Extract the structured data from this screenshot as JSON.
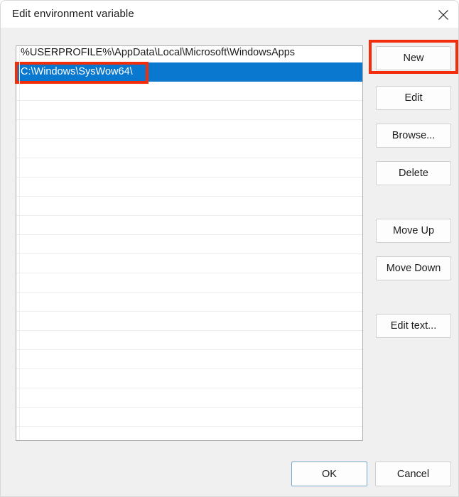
{
  "window": {
    "title": "Edit environment variable",
    "close_icon": "close-icon"
  },
  "list": {
    "rows": [
      {
        "text": "%USERPROFILE%\\AppData\\Local\\Microsoft\\WindowsApps",
        "selected": false
      },
      {
        "text": "C:\\Windows\\SysWow64\\",
        "selected": true
      },
      {
        "text": "",
        "selected": false
      },
      {
        "text": "",
        "selected": false
      },
      {
        "text": "",
        "selected": false
      },
      {
        "text": "",
        "selected": false
      },
      {
        "text": "",
        "selected": false
      },
      {
        "text": "",
        "selected": false
      },
      {
        "text": "",
        "selected": false
      },
      {
        "text": "",
        "selected": false
      },
      {
        "text": "",
        "selected": false
      },
      {
        "text": "",
        "selected": false
      },
      {
        "text": "",
        "selected": false
      },
      {
        "text": "",
        "selected": false
      },
      {
        "text": "",
        "selected": false
      },
      {
        "text": "",
        "selected": false
      },
      {
        "text": "",
        "selected": false
      },
      {
        "text": "",
        "selected": false
      },
      {
        "text": "",
        "selected": false
      },
      {
        "text": "",
        "selected": false
      },
      {
        "text": "",
        "selected": false
      }
    ],
    "selection_color": "#0b78d0"
  },
  "side_buttons": {
    "new": "New",
    "edit": "Edit",
    "browse": "Browse...",
    "delete": "Delete",
    "move_up": "Move Up",
    "move_down": "Move Down",
    "edit_text": "Edit text..."
  },
  "footer": {
    "ok": "OK",
    "cancel": "Cancel"
  },
  "annotations": {
    "color": "#f22d0c",
    "targets": [
      "selected-list-row",
      "new-button"
    ]
  }
}
